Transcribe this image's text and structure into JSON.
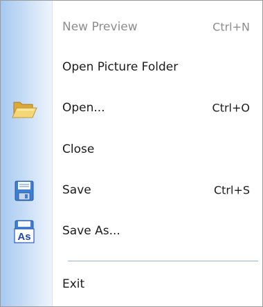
{
  "menu": {
    "items": [
      {
        "label": "New Preview",
        "shortcut": "Ctrl+N",
        "enabled": false
      },
      {
        "label": "Open Picture Folder",
        "shortcut": ""
      },
      {
        "label": "Open...",
        "shortcut": "Ctrl+O",
        "icon": "folder-open-icon"
      },
      {
        "label": "Close",
        "shortcut": ""
      },
      {
        "label": "Save",
        "shortcut": "Ctrl+S",
        "icon": "floppy-disk-icon"
      },
      {
        "label": "Save As...",
        "shortcut": "",
        "icon": "save-as-icon",
        "icon_text": "As"
      },
      {
        "label": "Exit",
        "shortcut": ""
      }
    ]
  }
}
